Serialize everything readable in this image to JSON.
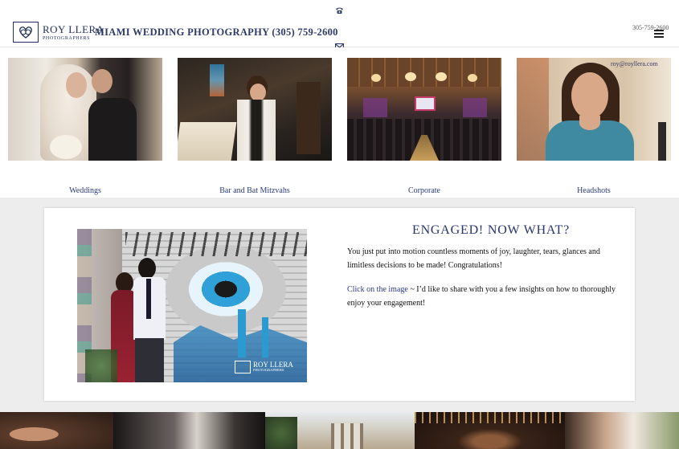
{
  "header": {
    "logo_name": "ROY LLERA",
    "logo_sub": "PHOTOGRAPHERS",
    "tagline": "MIAMI WEDDING PHOTOGRAPHY (305) 759-2600",
    "phone": "305-759-2600",
    "email": "roy@royllera.com"
  },
  "categories": [
    {
      "label": "Weddings"
    },
    {
      "label": "Bar and Bat Mitzvahs"
    },
    {
      "label": "Corporate"
    },
    {
      "label": "Headshots"
    }
  ],
  "feature": {
    "title": "ENGAGED! NOW WHAT?",
    "para1": "You just put into motion countless moments of joy, laughter, tears, glances and limitless decisions to be made! Congratulations!",
    "link_text": "Click on the image",
    "para2_rest": " ~ I’d like to share with you a few insights on how to thoroughly enjoy your engagement!",
    "watermark_name": "ROY LLERA",
    "watermark_sub": "PHOTOGRAPHERS"
  },
  "colors": {
    "brand_navy": "#23305e",
    "link_blue": "#2a3a8a",
    "page_bg": "#ededed"
  },
  "icons": [
    "phone-icon",
    "mail-icon",
    "hamburger-menu-icon",
    "logo-mark-icon"
  ]
}
